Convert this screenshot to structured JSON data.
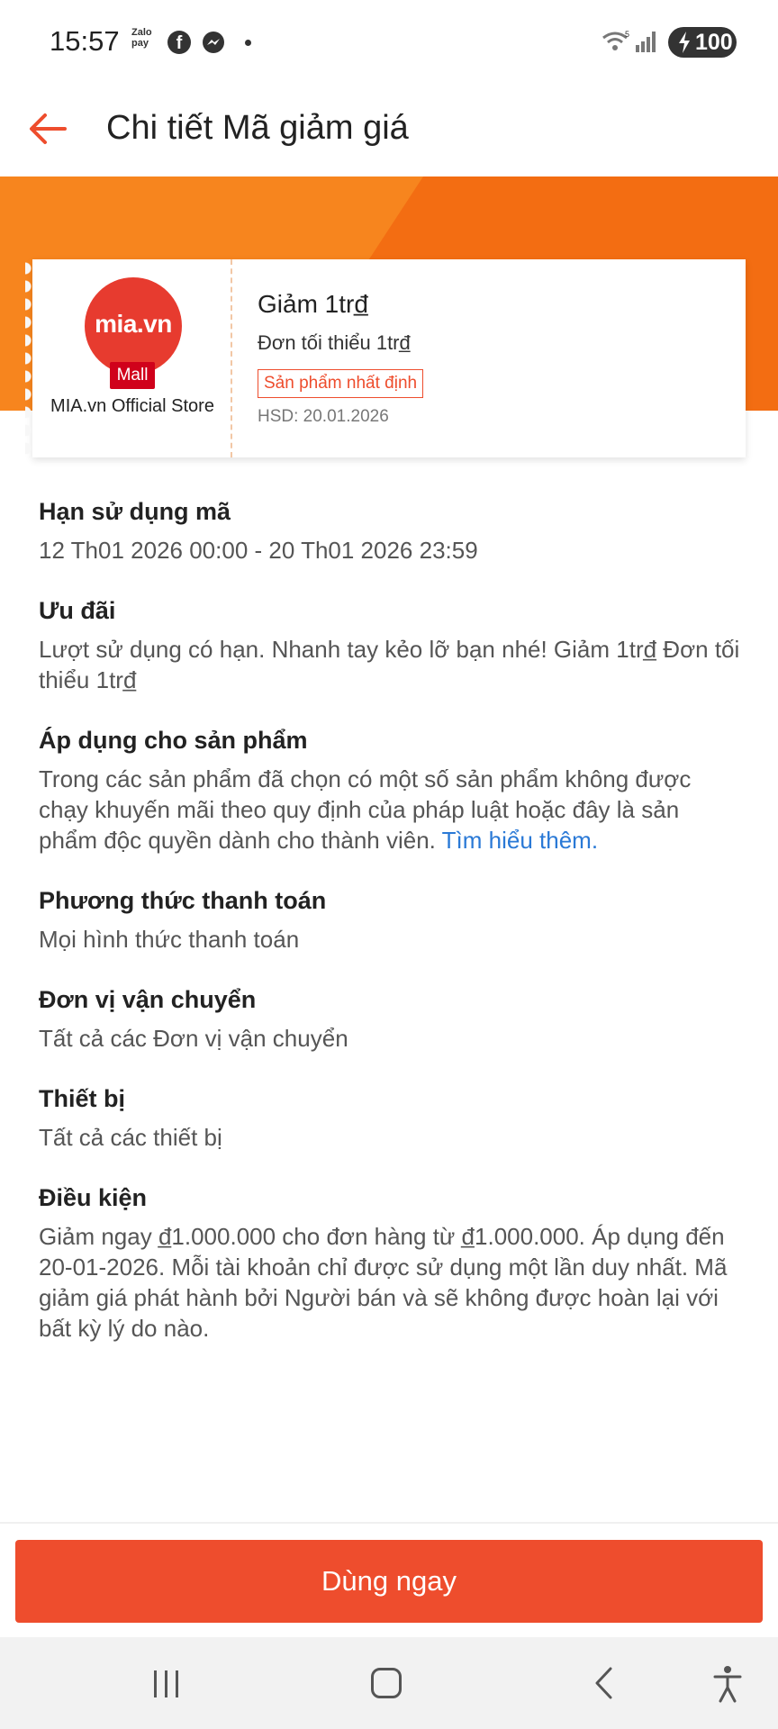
{
  "status_bar": {
    "time": "15:57",
    "zalopay_line1": "Zalo",
    "zalopay_line2": "pay",
    "battery": "100",
    "icons": [
      "facebook-icon",
      "messenger-icon",
      "wifi-icon",
      "signal-icon",
      "battery-icon"
    ]
  },
  "header": {
    "title": "Chi tiết Mã giảm giá",
    "back_icon": "arrow-left-icon"
  },
  "colors": {
    "accent": "#ee4d2d",
    "banner": "#f36d12",
    "link": "#2a79d6"
  },
  "voucher": {
    "logo_text": "mia.vn",
    "mall_badge": "Mall",
    "store_name": "MIA.vn Official Store",
    "title": "Giảm 1trđ̲",
    "min_order": "Đơn tối thiểu 1trđ̲",
    "tag": "Sản phẩm nhất định",
    "expiry": "HSD: 20.01.2026"
  },
  "sections": [
    {
      "title": "Hạn sử dụng mã",
      "body": "12 Th01 2026 00:00 - 20 Th01 2026 23:59"
    },
    {
      "title": "Ưu đãi",
      "body": "Lượt sử dụng có hạn. Nhanh tay kẻo lỡ bạn nhé! Giảm 1trđ̲ Đơn tối thiểu 1trđ̲"
    },
    {
      "title": "Áp dụng cho sản phẩm",
      "body": "Trong các sản phẩm đã chọn có một số sản phẩm không được chạy khuyến mãi theo quy định của pháp luật hoặc đây là sản phẩm độc quyền dành cho thành viên.",
      "link": "Tìm hiểu thêm."
    },
    {
      "title": "Phương thức thanh toán",
      "body": "Mọi hình thức thanh toán"
    },
    {
      "title": "Đơn vị vận chuyển",
      "body": "Tất cả các Đơn vị vận chuyển"
    },
    {
      "title": "Thiết bị",
      "body": "Tất cả các thiết bị"
    },
    {
      "title": "Điều kiện",
      "body": "Giảm ngay đ̲1.000.000 cho đơn hàng từ đ̲1.000.000. Áp dụng đến 20-01-2026. Mỗi tài khoản chỉ được sử dụng một lần duy nhất. Mã giảm giá phát hành bởi Người bán và sẽ không được hoàn lại với bất kỳ lý do nào."
    }
  ],
  "action": {
    "use_now": "Dùng ngay"
  },
  "navbar": {
    "icons": [
      "recents-icon",
      "home-icon",
      "back-icon",
      "accessibility-icon"
    ]
  }
}
